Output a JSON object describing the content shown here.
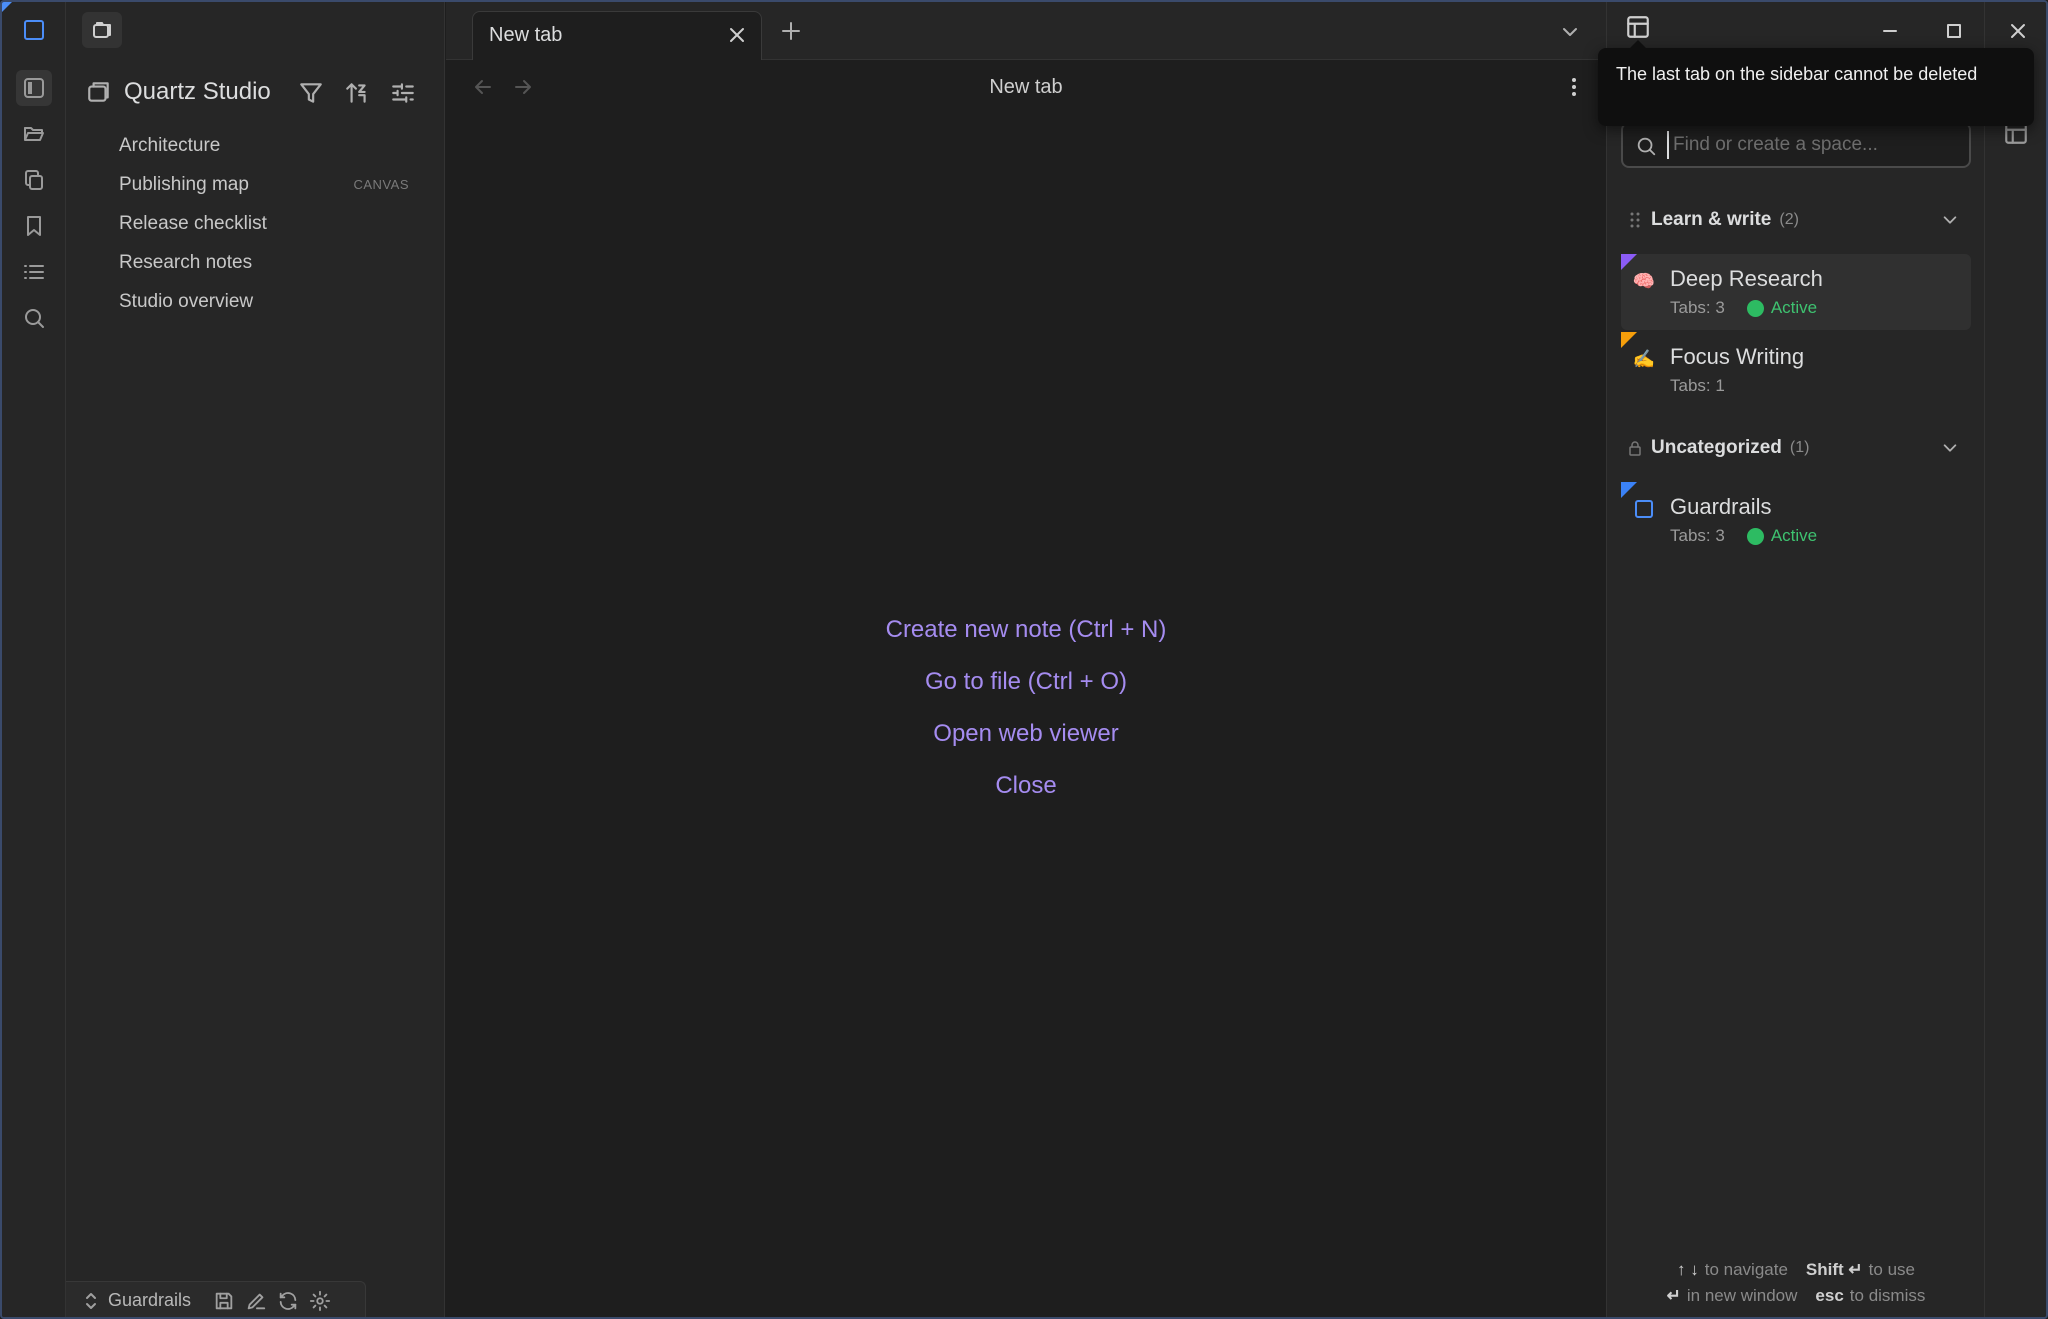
{
  "vault": {
    "name": "Quartz Studio",
    "files": [
      {
        "name": "Architecture",
        "tag": ""
      },
      {
        "name": "Publishing map",
        "tag": "CANVAS"
      },
      {
        "name": "Release checklist",
        "tag": ""
      },
      {
        "name": "Research notes",
        "tag": ""
      },
      {
        "name": "Studio overview",
        "tag": ""
      }
    ],
    "footer_name": "Guardrails"
  },
  "tab": {
    "title": "New tab"
  },
  "view": {
    "title": "New tab"
  },
  "empty_actions": {
    "create_note": "Create new note (Ctrl + N)",
    "go_to_file": "Go to file (Ctrl + O)",
    "open_web_viewer": "Open web viewer",
    "close": "Close"
  },
  "tooltip": {
    "text": "The last tab on the sidebar cannot be deleted"
  },
  "spaces": {
    "search_placeholder": "Find or create a space...",
    "groups": [
      {
        "title": "Learn & write",
        "count": "(2)",
        "items": [
          {
            "name": "Deep Research",
            "tabs": "Tabs: 3",
            "status": "Active",
            "icon": "🧠",
            "flag_color": "#8b5cf6"
          },
          {
            "name": "Focus Writing",
            "tabs": "Tabs: 1",
            "status": "",
            "icon": "✍️",
            "flag_color": "#f59e0b"
          }
        ]
      },
      {
        "title": "Uncategorized",
        "count": "(1)",
        "items": [
          {
            "name": "Guardrails",
            "tabs": "Tabs: 3",
            "status": "Active",
            "icon": "☐",
            "flag_color": "#3b82f6"
          }
        ]
      }
    ]
  },
  "hints": {
    "navigate_keys": "↑ ↓",
    "navigate_label": "to navigate",
    "use_key": "Shift ↵",
    "use_label": "to use",
    "enter_key": "↵",
    "new_window_label": "in new window",
    "esc_key": "esc",
    "dismiss_label": "to dismiss"
  },
  "colors": {
    "accent": "#a58cf0",
    "active": "#2dbb62",
    "background": "#1e1e1e",
    "panel": "#262626"
  }
}
